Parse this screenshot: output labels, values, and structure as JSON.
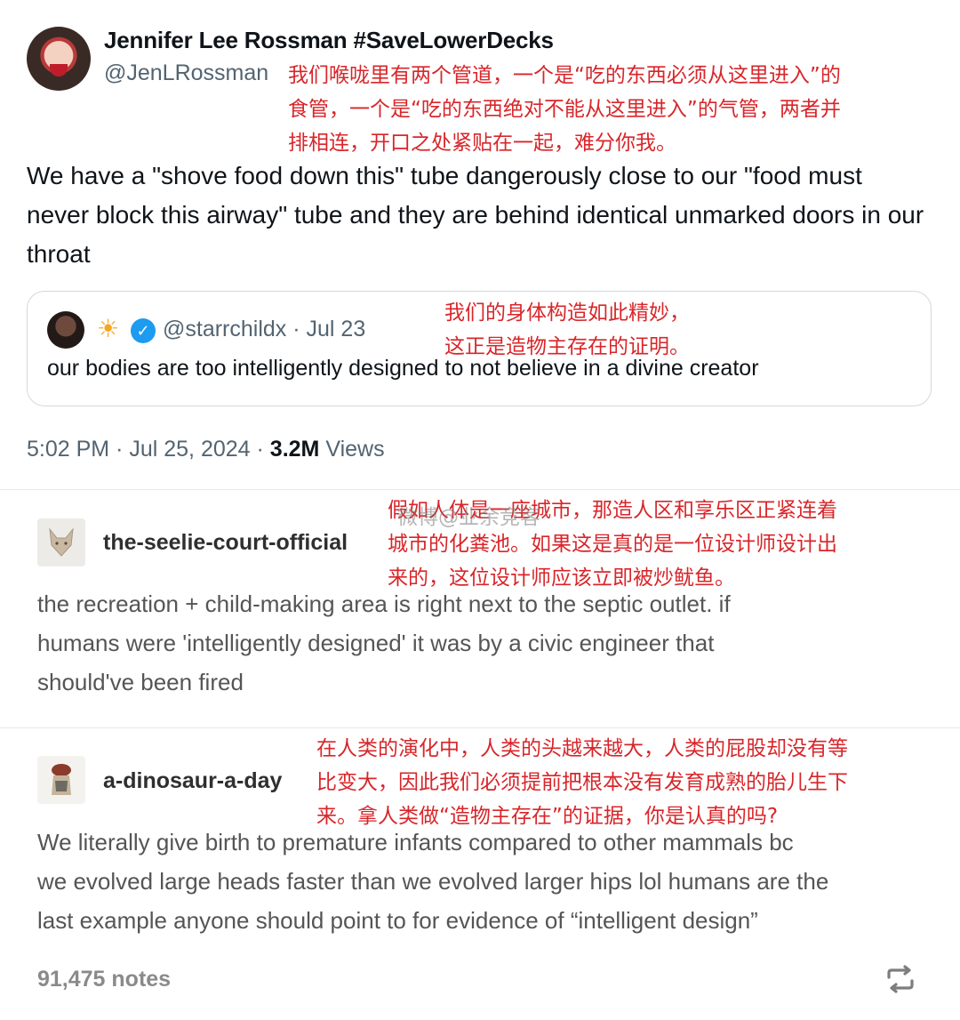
{
  "tweet": {
    "display_name": "Jennifer Lee Rossman #SaveLowerDecks",
    "handle": "@JenLRossman",
    "text": "We have a \"shove food down this\" tube dangerously close to our \"food must never block this airway\" tube and they are behind identical unmarked doors in our throat",
    "annotation_lines": [
      "我们喉咙里有两个管道，一个是“吃的东西必须从这里进入”的",
      "食管，一个是“吃的东西绝对不能从这里进入”的气管，两者并",
      "排相连，开口之处紧贴在一起，难分你我。"
    ],
    "quote": {
      "handle": "@starrchildx",
      "date": "Jul 23",
      "emoji": "☀",
      "text": "our bodies are too intelligently designed to not believe in a divine creator",
      "annotation_lines": [
        "我们的身体构造如此精妙，",
        "这正是造物主存在的证明。"
      ]
    },
    "time": "5:02 PM",
    "date": "Jul 25, 2024",
    "views_count": "3.2M",
    "views_label": "Views"
  },
  "posts": [
    {
      "blog_name": "the-seelie-court-official",
      "lines": [
        "the recreation + child-making area is right next to the septic outlet. if",
        "humans were 'intelligently designed' it was by a civic engineer that",
        "should've been fired"
      ],
      "annotation_lines": [
        "假如人体是一座城市，那造人区和享乐区正紧连着",
        "城市的化粪池。如果这是真的是一位设计师设计出",
        "来的，这位设计师应该立即被炒鱿鱼。"
      ]
    },
    {
      "blog_name": "a-dinosaur-a-day",
      "lines": [
        "We literally give birth to premature infants compared to other mammals bc",
        "we evolved large heads faster than we evolved larger hips lol humans are the",
        "last example anyone should point to for evidence of “intelligent design”"
      ],
      "annotation_lines": [
        "在人类的演化中，人类的头越来越大，人类的屁股却没有等",
        "比变大，因此我们必须提前把根本没有发育成熟的胎儿生下",
        "来。拿人类做“造物主存在”的证据，你是认真的吗?"
      ],
      "notes": "91,475 notes"
    }
  ],
  "watermark": "微博@业余竞客",
  "colors": {
    "annotation": "#d8262a",
    "verified": "#1d9bf0",
    "muted": "#536471"
  }
}
